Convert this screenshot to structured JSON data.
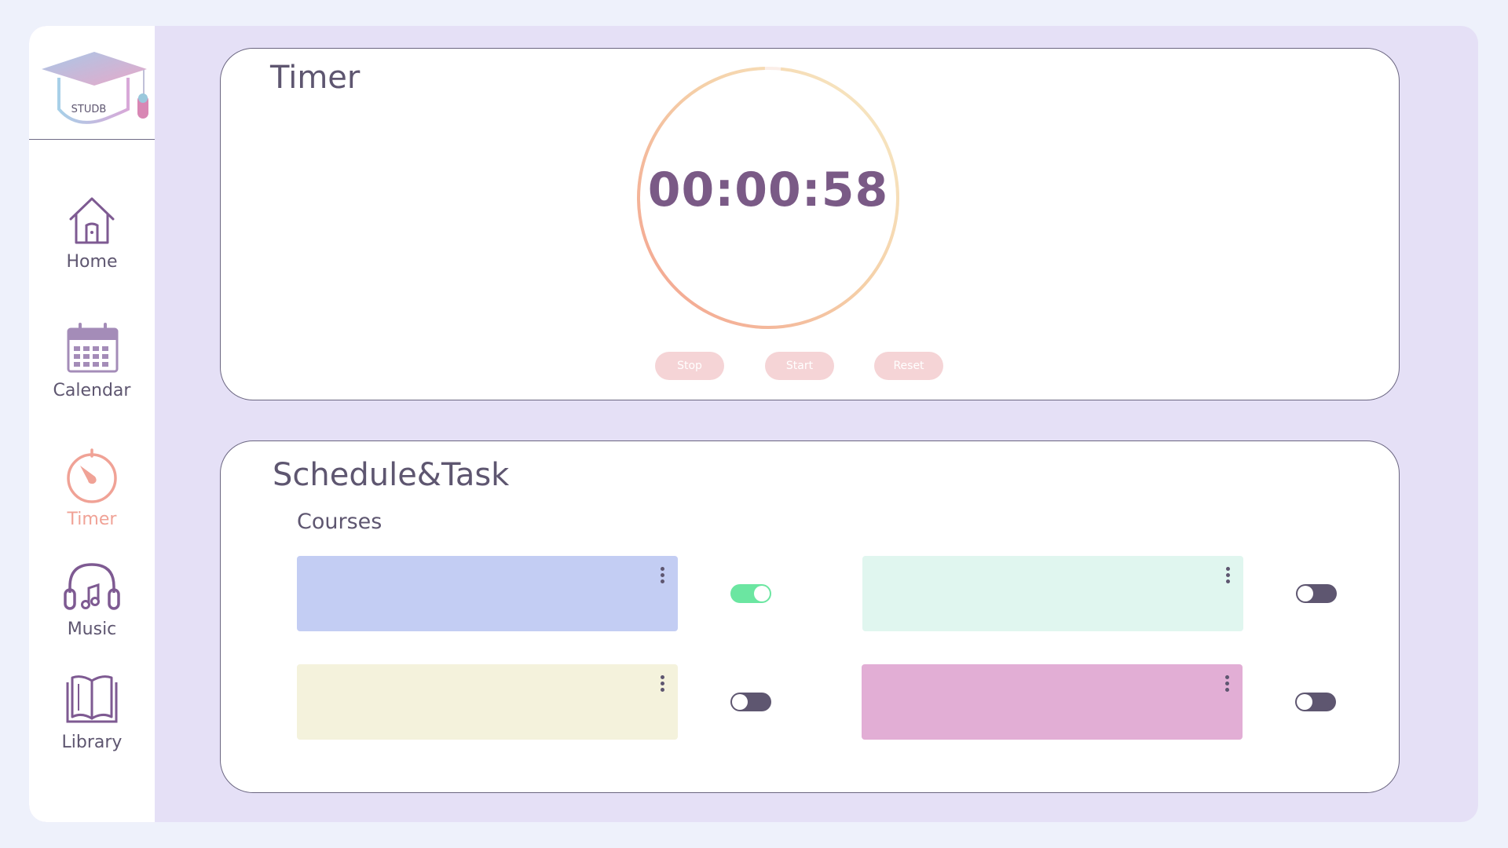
{
  "app": {
    "logo_text": "STUDB"
  },
  "sidebar": {
    "items": [
      {
        "label": "Home",
        "icon": "home-icon",
        "active": false
      },
      {
        "label": "Calendar",
        "icon": "calendar-icon",
        "active": false
      },
      {
        "label": "Timer",
        "icon": "timer-icon",
        "active": true
      },
      {
        "label": "Music",
        "icon": "headphones-icon",
        "active": false
      },
      {
        "label": "Library",
        "icon": "book-icon",
        "active": false
      }
    ]
  },
  "timer": {
    "title": "Timer",
    "display": "00:00:58",
    "ring_progress": 0.98,
    "buttons": {
      "stop": "Stop",
      "start": "Start",
      "reset": "Reset"
    }
  },
  "schedule": {
    "title": "Schedule&Task",
    "courses_label": "Courses",
    "courses": [
      {
        "color": "#c3cdf3",
        "toggle_on": true
      },
      {
        "color": "#e0f6ef",
        "toggle_on": false
      },
      {
        "color": "#f4f2dc",
        "toggle_on": false
      },
      {
        "color": "#e2aed5",
        "toggle_on": false
      }
    ]
  },
  "colors": {
    "accent": "#f0a296",
    "text": "#5e5670",
    "timer_text": "#7a5a86",
    "toggle_on": "#6be6a1",
    "toggle_off": "#5e5670",
    "button_bg": "#f5d4d6",
    "app_bg": "#e5e0f6"
  }
}
